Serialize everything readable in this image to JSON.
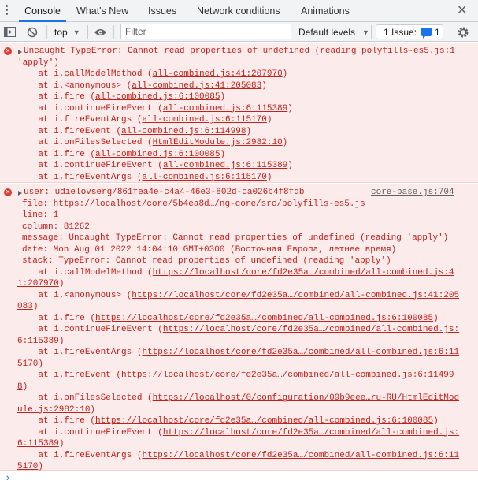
{
  "tabs": [
    "Console",
    "What's New",
    "Issues",
    "Network conditions",
    "Animations"
  ],
  "toolbar": {
    "context": "top",
    "filter_placeholder": "Filter",
    "levels": "Default levels",
    "issues_label": "1 Issue:",
    "issues_count": "1"
  },
  "error1": {
    "message": "Uncaught TypeError: Cannot read properties of undefined (reading ",
    "source": "polyfills-es5.js:1",
    "message_cont": "'apply')",
    "stack": [
      {
        "prefix": "    at i.callModelMethod (",
        "link": "all-combined.js:41:207970",
        "suffix": ")"
      },
      {
        "prefix": "    at i.<anonymous> (",
        "link": "all-combined.js:41:205083",
        "suffix": ")"
      },
      {
        "prefix": "    at i.fire (",
        "link": "all-combined.js:6:100085",
        "suffix": ")"
      },
      {
        "prefix": "    at i.continueFireEvent (",
        "link": "all-combined.js:6:115389",
        "suffix": ")"
      },
      {
        "prefix": "    at i.fireEventArgs (",
        "link": "all-combined.js:6:115170",
        "suffix": ")"
      },
      {
        "prefix": "    at i.fireEvent (",
        "link": "all-combined.js:6:114998",
        "suffix": ")"
      },
      {
        "prefix": "    at i.onFilesSelected (",
        "link": "HtmlEditModule.js:2982:10",
        "suffix": ")"
      },
      {
        "prefix": "    at i.fire (",
        "link": "all-combined.js:6:100085",
        "suffix": ")"
      },
      {
        "prefix": "    at i.continueFireEvent (",
        "link": "all-combined.js:6:115389",
        "suffix": ")"
      },
      {
        "prefix": "    at i.fireEventArgs (",
        "link": "all-combined.js:6:115170",
        "suffix": ")"
      }
    ]
  },
  "error2": {
    "user": "user: udielovserg/861fea4e-c4a4-46e3-802d-ca026b4f8fdb",
    "source": "core-base.js:704",
    "file_prefix": "file: ",
    "file_link": "https://localhost/core/5b4ea8d…/ng-core/src/polyfills-es5.js",
    "line": "line: 1",
    "column": "column: 81262",
    "message": "message: Uncaught TypeError: Cannot read properties of undefined (reading 'apply')",
    "date": "date: Mon Aug 01 2022 14:04:10 GMT+0300 (Восточная Европа, летнее время)",
    "stack_head": "stack: TypeError: Cannot read properties of undefined (reading 'apply')",
    "stack_lines": [
      {
        "prefix": "    at i.callModelMethod (",
        "link1": "https://localhost/core/fd2e35a…/combined/all-combined.js:4",
        "link2": "1:207970",
        "suffix": ")"
      },
      {
        "prefix": "    at i.<anonymous> (",
        "link1": "https://localhost/core/fd2e35a…/combined/all-combined.js:41:205",
        "link2": "083",
        "suffix": ")"
      },
      {
        "prefix": "    at i.fire (",
        "link1": "https://localhost/core/fd2e35a…/combined/all-combined.js:6:100085",
        "link2": "",
        "suffix": ")"
      },
      {
        "prefix": "    at i.continueFireEvent (",
        "link1": "https://localhost/core/fd2e35a…/combined/all-combined.js:",
        "link2": "6:115389",
        "suffix": ")"
      },
      {
        "prefix": "    at i.fireEventArgs (",
        "link1": "https://localhost/core/fd2e35a…/combined/all-combined.js:6:11",
        "link2": "5170",
        "suffix": ")"
      },
      {
        "prefix": "    at i.fireEvent (",
        "link1": "https://localhost/core/fd2e35a…/combined/all-combined.js:6:11499",
        "link2": "8",
        "suffix": ")"
      },
      {
        "prefix": "    at i.onFilesSelected (",
        "link1": "https://localhost/0/configuration/09b9eee…ru-RU/HtmlEditMod",
        "link2": "ule.js:2982:10",
        "suffix": ")"
      },
      {
        "prefix": "    at i.fire (",
        "link1": "https://localhost/core/fd2e35a…/combined/all-combined.js:6:100085",
        "link2": "",
        "suffix": ")"
      },
      {
        "prefix": "    at i.continueFireEvent (",
        "link1": "https://localhost/core/fd2e35a…/combined/all-combined.js:",
        "link2": "6:115389",
        "suffix": ")"
      },
      {
        "prefix": "    at i.fireEventArgs (",
        "link1": "https://localhost/core/fd2e35a…/combined/all-combined.js:6:11",
        "link2": "5170",
        "suffix": ")"
      }
    ]
  },
  "prompt": "›"
}
